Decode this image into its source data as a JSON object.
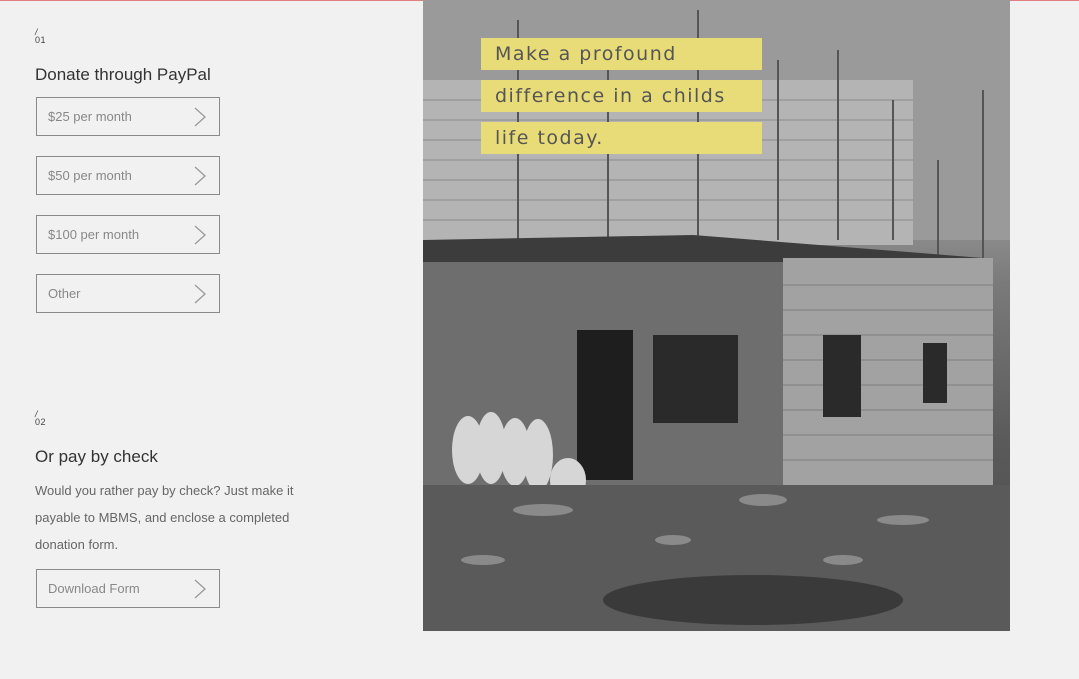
{
  "section1": {
    "marker_slash": "/",
    "marker_number": "01",
    "title": "Donate through PayPal",
    "options": [
      {
        "label": "$25 per month"
      },
      {
        "label": "$50 per month"
      },
      {
        "label": "$100 per month"
      },
      {
        "label": "Other"
      }
    ]
  },
  "section2": {
    "marker_slash": "/",
    "marker_number": "02",
    "title": "Or pay by check",
    "body": "Would you rather pay by check? Just make it payable to MBMS, and enclose a completed donation form.",
    "download_label": "Download Form"
  },
  "hero": {
    "tagline_lines": [
      "Make a profound",
      "difference in a childs",
      "life today."
    ],
    "highlight_color": "#e8dc78"
  },
  "colors": {
    "accent_line": "#e08080",
    "background": "#f1f1f1",
    "button_border": "#8a8a8a"
  }
}
